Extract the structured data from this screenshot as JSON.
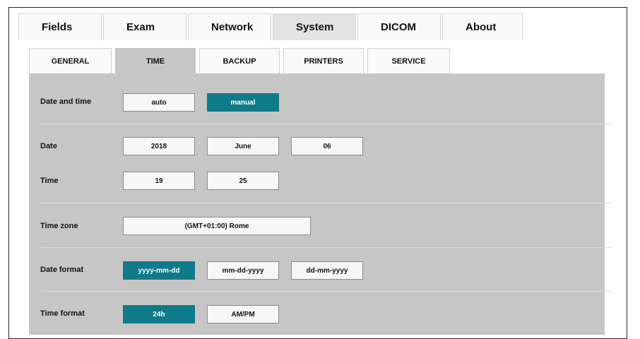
{
  "main_tabs": [
    {
      "label": "Fields",
      "active": false
    },
    {
      "label": "Exam",
      "active": false
    },
    {
      "label": "Network",
      "active": false
    },
    {
      "label": "System",
      "active": true
    },
    {
      "label": "DICOM",
      "active": false
    },
    {
      "label": "About",
      "active": false
    }
  ],
  "sub_tabs": [
    {
      "label": "GENERAL",
      "active": false
    },
    {
      "label": "TIME",
      "active": true
    },
    {
      "label": "BACKUP",
      "active": false
    },
    {
      "label": "PRINTERS",
      "active": false
    },
    {
      "label": "SERVICE",
      "active": false
    }
  ],
  "settings": {
    "date_and_time": {
      "label": "Date and time",
      "options": [
        "auto",
        "manual"
      ],
      "selected": "manual"
    },
    "date": {
      "label": "Date",
      "year": "2018",
      "month": "June",
      "day": "06"
    },
    "time": {
      "label": "Time",
      "hour": "19",
      "minute": "25"
    },
    "time_zone": {
      "label": "Time zone",
      "value": "(GMT+01:00) Rome"
    },
    "date_format": {
      "label": "Date format",
      "options": [
        "yyyy-mm-dd",
        "mm-dd-yyyy",
        "dd-mm-yyyy"
      ],
      "selected": "yyyy-mm-dd"
    },
    "time_format": {
      "label": "Time format",
      "options": [
        "24h",
        "AM/PM"
      ],
      "selected": "24h"
    }
  },
  "colors": {
    "accent": "#0f7a89",
    "panel": "#c6c6c6",
    "active_tab": "#e3e3e3"
  }
}
